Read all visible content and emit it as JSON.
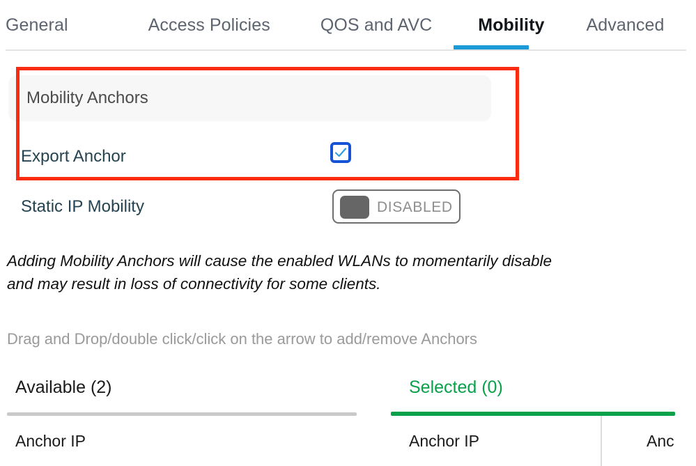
{
  "tabs": [
    {
      "label": "General",
      "active": false
    },
    {
      "label": "Access Policies",
      "active": false
    },
    {
      "label": "QOS and AVC",
      "active": false
    },
    {
      "label": "Mobility",
      "active": true
    },
    {
      "label": "Advanced",
      "active": false
    }
  ],
  "panel": {
    "title": "Mobility Anchors",
    "highlight_color": "#fa2b10"
  },
  "export_anchor": {
    "label": "Export Anchor",
    "checked": true,
    "accent_color": "#1552d6"
  },
  "static_ip_mobility": {
    "label": "Static IP Mobility",
    "toggle_state": "DISABLED"
  },
  "warning": {
    "line1": "Adding Mobility Anchors will cause the enabled WLANs to momentarily disable",
    "line2": "and may result in loss of connectivity for some clients."
  },
  "hint": "Drag and Drop/double click/click on the arrow to add/remove Anchors",
  "available_list": {
    "title": "Available (2)",
    "columns": [
      "Anchor IP"
    ]
  },
  "selected_list": {
    "title": "Selected (0)",
    "accent_color": "#0aa14b",
    "columns": [
      "Anchor IP",
      "Anc"
    ]
  }
}
